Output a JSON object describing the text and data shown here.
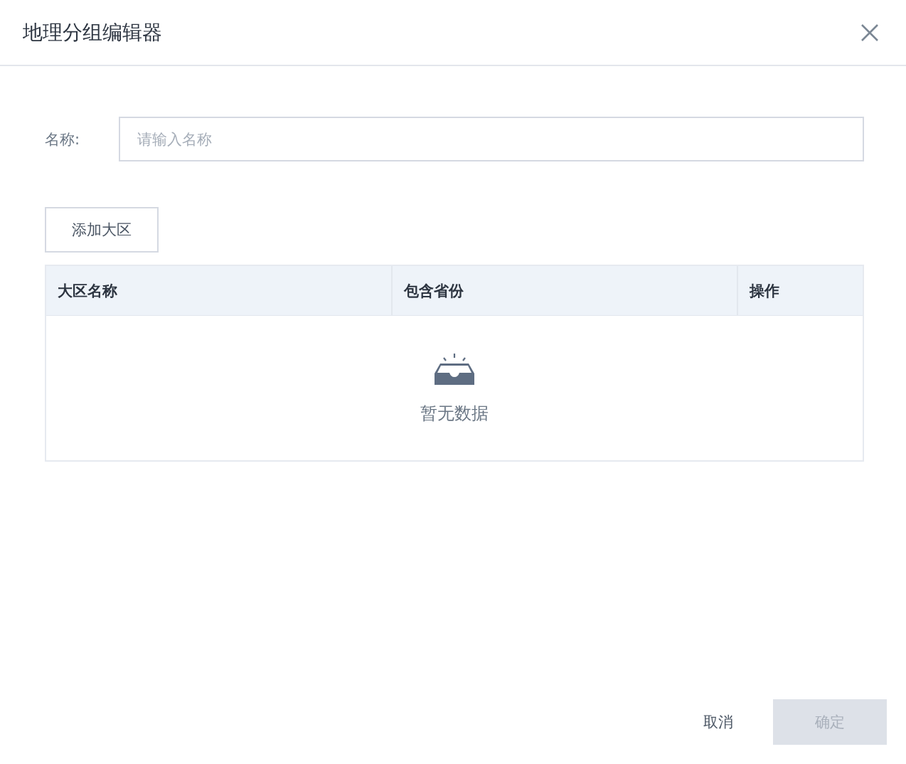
{
  "dialog": {
    "title": "地理分组编辑器"
  },
  "form": {
    "name_label": "名称:",
    "name_field": {
      "placeholder": "请输入名称"
    }
  },
  "add_button": "添加大区",
  "table": {
    "columns": [
      "大区名称",
      "包含省份",
      "操作"
    ],
    "empty_text": "暂无数据"
  },
  "footer": {
    "buttons": [
      {
        "label": "取消",
        "kind": "text",
        "disabled": false
      },
      {
        "label": "确定",
        "kind": "primary",
        "disabled": true
      }
    ]
  }
}
